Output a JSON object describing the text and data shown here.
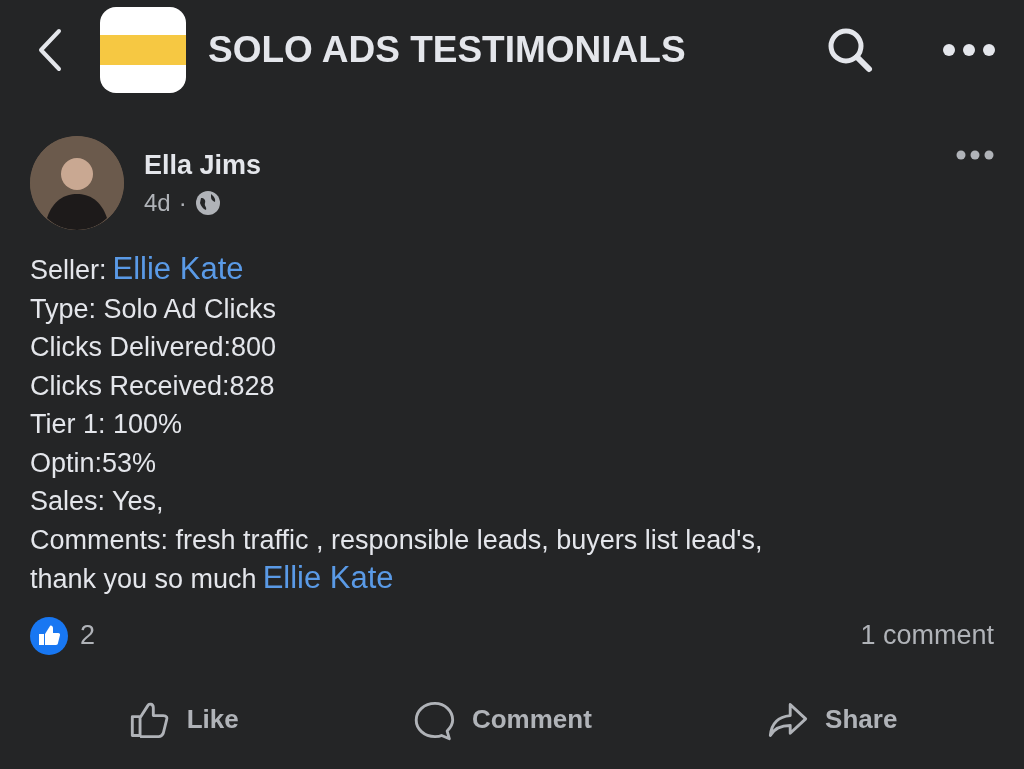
{
  "header": {
    "title": "SOLO ADS TESTIMONIALS"
  },
  "post": {
    "author": "Ella Jims",
    "time": "4d",
    "separator": "·",
    "lines": [
      {
        "text": "Seller:",
        "mention": "Ellie Kate"
      },
      {
        "text": "Type: Solo Ad Clicks"
      },
      {
        "text": "Clicks Delivered:800"
      },
      {
        "text": "Clicks Received:828"
      },
      {
        "text": "Tier 1: 100%"
      },
      {
        "text": "Optin:53%"
      },
      {
        "text": "Sales: Yes,"
      },
      {
        "text": "Comments: fresh traffic , responsible leads, buyers list lead's,"
      },
      {
        "text": "thank you so much",
        "mention": "Ellie Kate"
      }
    ],
    "reactions": "2",
    "comments": "1 comment",
    "actions": [
      {
        "kind": "like",
        "label": "Like"
      },
      {
        "kind": "comment",
        "label": "Comment"
      },
      {
        "kind": "share",
        "label": "Share"
      }
    ]
  }
}
